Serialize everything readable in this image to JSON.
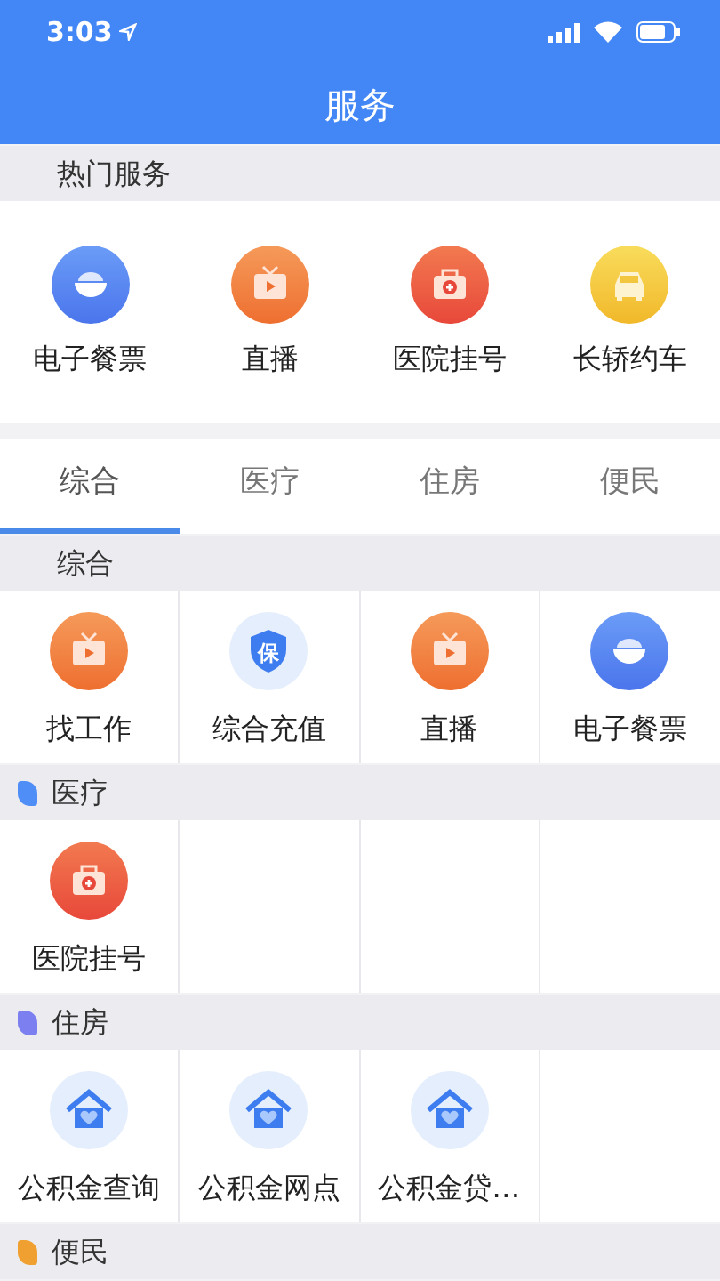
{
  "status_bar": {
    "time": "3:03"
  },
  "title": "服务",
  "hot": {
    "title": "热门服务",
    "items": [
      {
        "label": "电子餐票",
        "kind": "bowl"
      },
      {
        "label": "直播",
        "kind": "tv"
      },
      {
        "label": "医院挂号",
        "kind": "medkit"
      },
      {
        "label": "长轿约车",
        "kind": "car"
      }
    ]
  },
  "tabs": [
    {
      "label": "综合",
      "selected": true
    },
    {
      "label": "医疗",
      "selected": false
    },
    {
      "label": "住房",
      "selected": false
    },
    {
      "label": "便民",
      "selected": false
    }
  ],
  "sections": [
    {
      "title": "综合",
      "items": [
        {
          "label": "找工作",
          "kind": "tv"
        },
        {
          "label": "综合充值",
          "kind": "shield",
          "glyph": "保"
        },
        {
          "label": "直播",
          "kind": "tv"
        },
        {
          "label": "电子餐票",
          "kind": "bowl"
        }
      ]
    },
    {
      "title": "医疗",
      "color": "#4f8ef7",
      "items": [
        {
          "label": "医院挂号",
          "kind": "medkit"
        }
      ]
    },
    {
      "title": "住房",
      "color": "#7b7ff0",
      "items": [
        {
          "label": "公积金查询",
          "kind": "house"
        },
        {
          "label": "公积金网点",
          "kind": "house"
        },
        {
          "label": "公积金贷…",
          "kind": "house"
        }
      ]
    },
    {
      "title": "便民",
      "color": "#f0a030"
    }
  ]
}
